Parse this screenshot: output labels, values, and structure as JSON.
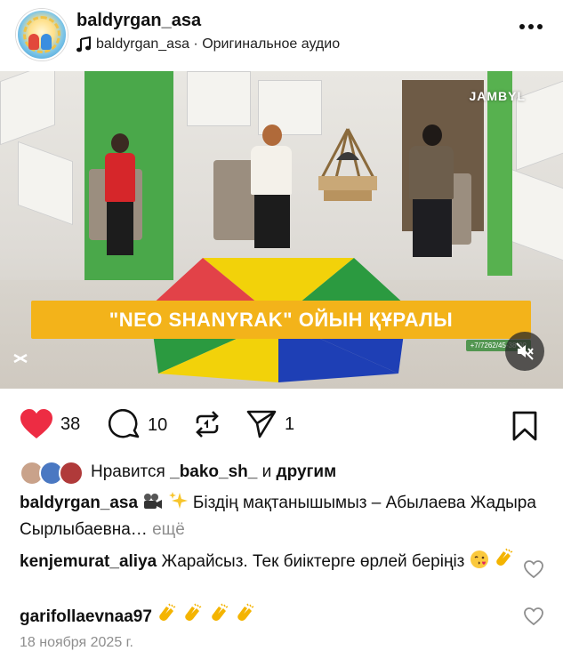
{
  "header": {
    "username": "baldyrgan_asa",
    "audio_text": "baldyrgan_asa · Оригинальное аудио",
    "icons": [
      "avatar",
      "music-note-icon",
      "more-options-icon"
    ]
  },
  "video": {
    "banner_text": "\"NEO SHANYRAK\" ОЙЫН ҚҰРАЛЫ",
    "channel_logo": "JAMBYL",
    "phone_strip": "+7/7262/45-38-00",
    "sound_state": "muted"
  },
  "actions": {
    "like_count": "38",
    "comment_count": "10",
    "share_count": "1",
    "liked": true,
    "colors": {
      "like_red": "#ed2c43",
      "text": "#111111",
      "muted_gray": "#8e8e8e"
    }
  },
  "likes": {
    "prefix": "Нравится ",
    "user": "_bako_sh_",
    "middle": " и ",
    "suffix": "другим"
  },
  "caption": {
    "user": "baldyrgan_asa",
    "text": "Біздің мақтанышымыз – Абылаева Жадыра Сырлыбаевна…",
    "more": "ещё"
  },
  "comments": [
    {
      "user": "kenjemurat_aliya",
      "text": "Жарайсыз. Тек биіктерге өрлей беріңіз"
    },
    {
      "user": "garifollaevnaa97",
      "text": ""
    }
  ],
  "date": "18 ноября 2025 г."
}
